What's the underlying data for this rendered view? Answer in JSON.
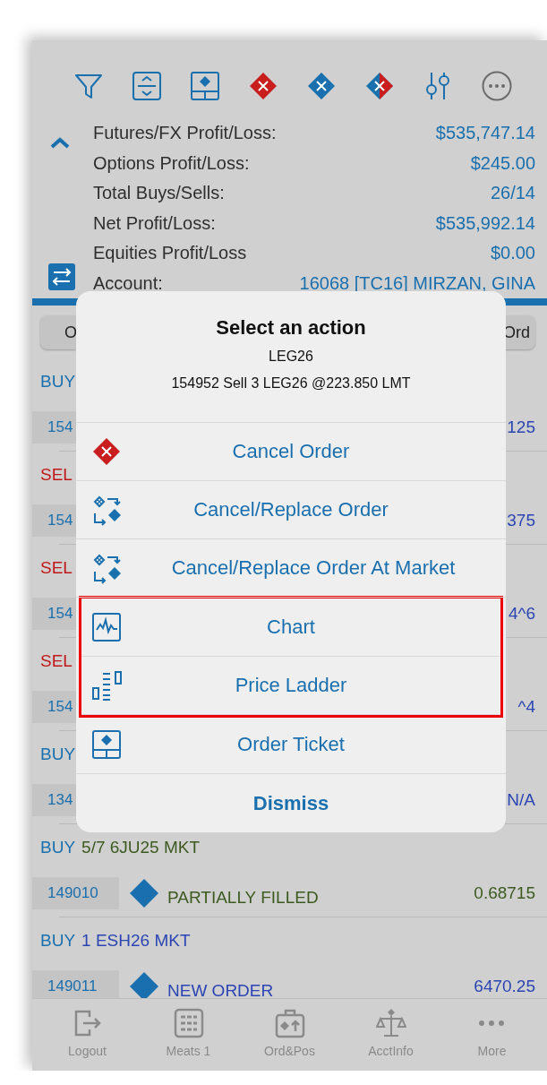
{
  "summary": {
    "rows": [
      {
        "label": "Futures/FX Profit/Loss:",
        "value": "$535,747.14"
      },
      {
        "label": "Options Profit/Loss:",
        "value": "$245.00"
      },
      {
        "label": "Total Buys/Sells:",
        "value": "26/14"
      },
      {
        "label": "Net Profit/Loss:",
        "value": "$535,992.14"
      },
      {
        "label": "Equities Profit/Loss",
        "value": "$0.00"
      },
      {
        "label": "Account:",
        "value": "16068 [TC16] MIRZAN, GINA"
      }
    ]
  },
  "segments": [
    {
      "label": "O"
    },
    {
      "label": "Ord"
    }
  ],
  "orders": [
    {
      "kind": "heading",
      "side": {
        "text": "BUY",
        "color": "#1a6fae"
      }
    },
    {
      "kind": "detail",
      "id": "154",
      "price": "125",
      "color": "#2b45b3"
    },
    {
      "kind": "heading",
      "side": {
        "text": "SEL",
        "color": "#c01818"
      }
    },
    {
      "kind": "detail",
      "id": "154",
      "price": "375",
      "color": "#2b45b3"
    },
    {
      "kind": "heading",
      "side": {
        "text": "SEL",
        "color": "#c01818"
      }
    },
    {
      "kind": "detail",
      "id": "154",
      "price": "4^6",
      "color": "#2b45b3"
    },
    {
      "kind": "heading",
      "side": {
        "text": "SEL",
        "color": "#c01818"
      }
    },
    {
      "kind": "detail",
      "id": "154",
      "price": "^4",
      "color": "#2b45b3"
    },
    {
      "kind": "heading",
      "side": {
        "text": "BUY",
        "color": "#1a6fae"
      }
    },
    {
      "kind": "detail",
      "id": "134",
      "price": "N/A",
      "color": "#2b45b3"
    },
    {
      "kind": "heading",
      "side": {
        "text": "BUY",
        "color": "#1a6fae"
      },
      "summary": {
        "text": "5/7 6JU25 MKT",
        "color": "#3c5a1f"
      }
    },
    {
      "kind": "detail",
      "id": "149010",
      "status": "PARTIALLY FILLED",
      "price": "0.68715",
      "color": "#3c5a1f"
    },
    {
      "kind": "heading",
      "side": {
        "text": "BUY",
        "color": "#1a6fae"
      },
      "summary": {
        "text": "1 ESH26 MKT",
        "color": "#2b45b3"
      }
    },
    {
      "kind": "detail",
      "id": "149011",
      "status": "NEW ORDER",
      "price": "6470.25",
      "color": "#2b45b3"
    }
  ],
  "dialog": {
    "title": "Select an action",
    "symbol": "LEG26",
    "details": "154952 Sell 3 LEG26 @223.850 LMT",
    "actions": [
      {
        "kind": "action",
        "label": "Cancel Order",
        "highlighted": false
      },
      {
        "kind": "action",
        "label": "Cancel/Replace Order",
        "highlighted": false
      },
      {
        "kind": "action",
        "label": "Cancel/Replace Order At Market",
        "highlighted": false
      },
      {
        "kind": "action",
        "label": "Chart",
        "highlighted": true
      },
      {
        "kind": "action",
        "label": "Price Ladder",
        "highlighted": true
      },
      {
        "kind": "action",
        "label": "Order Ticket",
        "highlighted": false
      },
      {
        "kind": "cancel",
        "label": "Dismiss",
        "highlighted": false
      }
    ]
  },
  "tab_bar": [
    {
      "label": "Logout"
    },
    {
      "label": "Meats 1"
    },
    {
      "label": "Ord&Pos"
    },
    {
      "label": "AcctInfo"
    },
    {
      "label": "More"
    }
  ]
}
